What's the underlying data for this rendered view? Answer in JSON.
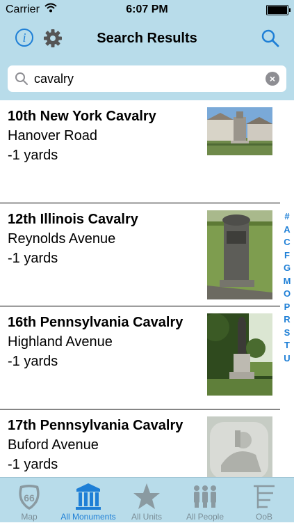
{
  "status": {
    "carrier": "Carrier",
    "time": "6:07 PM"
  },
  "nav": {
    "info_label": "i",
    "title": "Search Results"
  },
  "search": {
    "value": "cavalry",
    "clear_label": "×"
  },
  "results": [
    {
      "name": "10th New York Cavalry",
      "road": "Hanover Road",
      "distance": "-1 yards"
    },
    {
      "name": "12th Illinois Cavalry",
      "road": "Reynolds Avenue",
      "distance": "-1 yards"
    },
    {
      "name": "16th Pennsylvania Cavalry",
      "road": "Highland Avenue",
      "distance": "-1 yards"
    },
    {
      "name": "17th Pennsylvania Cavalry",
      "road": "Buford Avenue",
      "distance": "-1 yards"
    }
  ],
  "index_letters": [
    "#",
    "A",
    "C",
    "F",
    "G",
    "M",
    "O",
    "P",
    "R",
    "S",
    "T",
    "U"
  ],
  "tabs": [
    {
      "label": "Map",
      "icon": "route-66-shield-icon",
      "active": false
    },
    {
      "label": "All Monuments",
      "icon": "monument-columns-icon",
      "active": true
    },
    {
      "label": "All Units",
      "icon": "star-icon",
      "active": false
    },
    {
      "label": "All People",
      "icon": "people-icon",
      "active": false
    },
    {
      "label": "OoB",
      "icon": "order-of-battle-tree-icon",
      "active": false
    }
  ],
  "colors": {
    "bar": "#b8dcea",
    "accent": "#1e7fd6",
    "inactive": "#7a8d96"
  }
}
